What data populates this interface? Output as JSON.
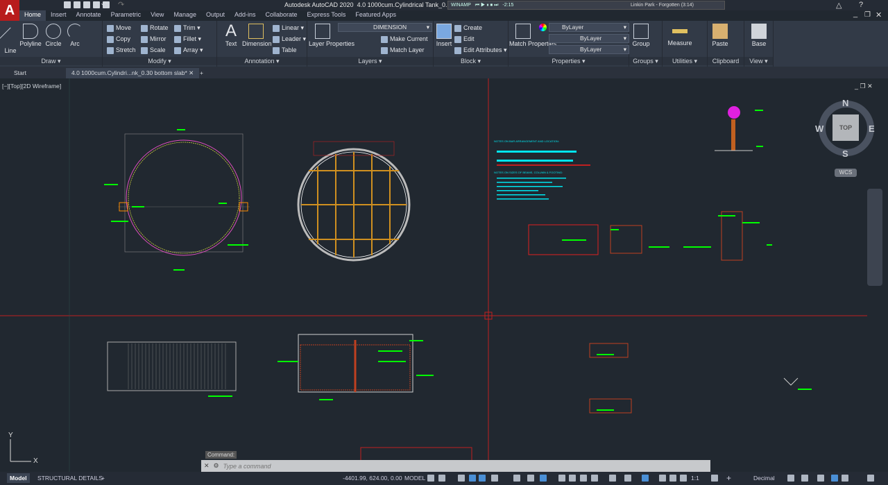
{
  "app": {
    "title": "Autodesk AutoCAD 2020",
    "document": "4.0 1000cum.Cylindrical Tank_0.30 botto",
    "logo": "A"
  },
  "winamp": {
    "label": "WINAMP",
    "time": "-2:15",
    "song": "Linkin Park - Forgotten (3:14)"
  },
  "ribbon_tabs": [
    "Home",
    "Insert",
    "Annotate",
    "Parametric",
    "View",
    "Manage",
    "Output",
    "Add-ins",
    "Collaborate",
    "Express Tools",
    "Featured Apps"
  ],
  "panels": {
    "draw": {
      "title": "Draw",
      "items": [
        "Line",
        "Polyline",
        "Circle",
        "Arc"
      ]
    },
    "modify": {
      "title": "Modify",
      "items": [
        "Move",
        "Rotate",
        "Trim",
        "Copy",
        "Mirror",
        "Fillet",
        "Stretch",
        "Scale",
        "Array"
      ]
    },
    "annotation": {
      "title": "Annotation",
      "items": [
        "Text",
        "Dimension",
        "Linear",
        "Leader",
        "Table"
      ]
    },
    "layers": {
      "title": "Layers",
      "layer_properties": "Layer Properties",
      "current_layer": "DIMENSION",
      "make_current": "Make Current",
      "match_layer": "Match Layer"
    },
    "block": {
      "title": "Block",
      "items": [
        "Insert",
        "Create",
        "Edit",
        "Edit Attributes"
      ]
    },
    "properties": {
      "title": "Properties",
      "match": "Match Properties",
      "color": "ByLayer",
      "linetype": "ByLayer",
      "lineweight": "ByLayer"
    },
    "groups": {
      "title": "Groups",
      "group": "Group"
    },
    "utilities": {
      "title": "Utilities",
      "measure": "Measure"
    },
    "clipboard": {
      "title": "Clipboard",
      "paste": "Paste"
    },
    "view": {
      "title": "View",
      "base": "Base"
    }
  },
  "file_tabs": {
    "start": "Start",
    "active": "4.0 1000cum.Cylindri...nk_0.30 bottom slab*"
  },
  "viewport": {
    "label": "[−][Top][2D Wireframe]"
  },
  "viewcube": {
    "n": "N",
    "s": "S",
    "e": "E",
    "w": "W",
    "face": "TOP",
    "wcs": "WCS"
  },
  "drawing": {
    "notes_heading_1": "NOTES ON BAR ARRANGEMENT AND LOCATION:",
    "notes_heading_2": "NOTES ON SIZES OF BEAMS, COLUMN & FOOTING:",
    "ucs_y": "Y",
    "ucs_x": "X"
  },
  "command": {
    "label": "Command:",
    "placeholder": "Type a command"
  },
  "status": {
    "layout_tabs": [
      "Model",
      "STRUCTURAL DETAILS"
    ],
    "coords": "-4401.99, 624.00, 0.00",
    "space": "MODEL",
    "scale": "1:1",
    "units": "Decimal"
  },
  "colors": {
    "background": "#212830",
    "crosshair": "#c0201f",
    "dims": "#00ff00",
    "rebar": "#ff8c00",
    "text": "#00e5ee"
  }
}
